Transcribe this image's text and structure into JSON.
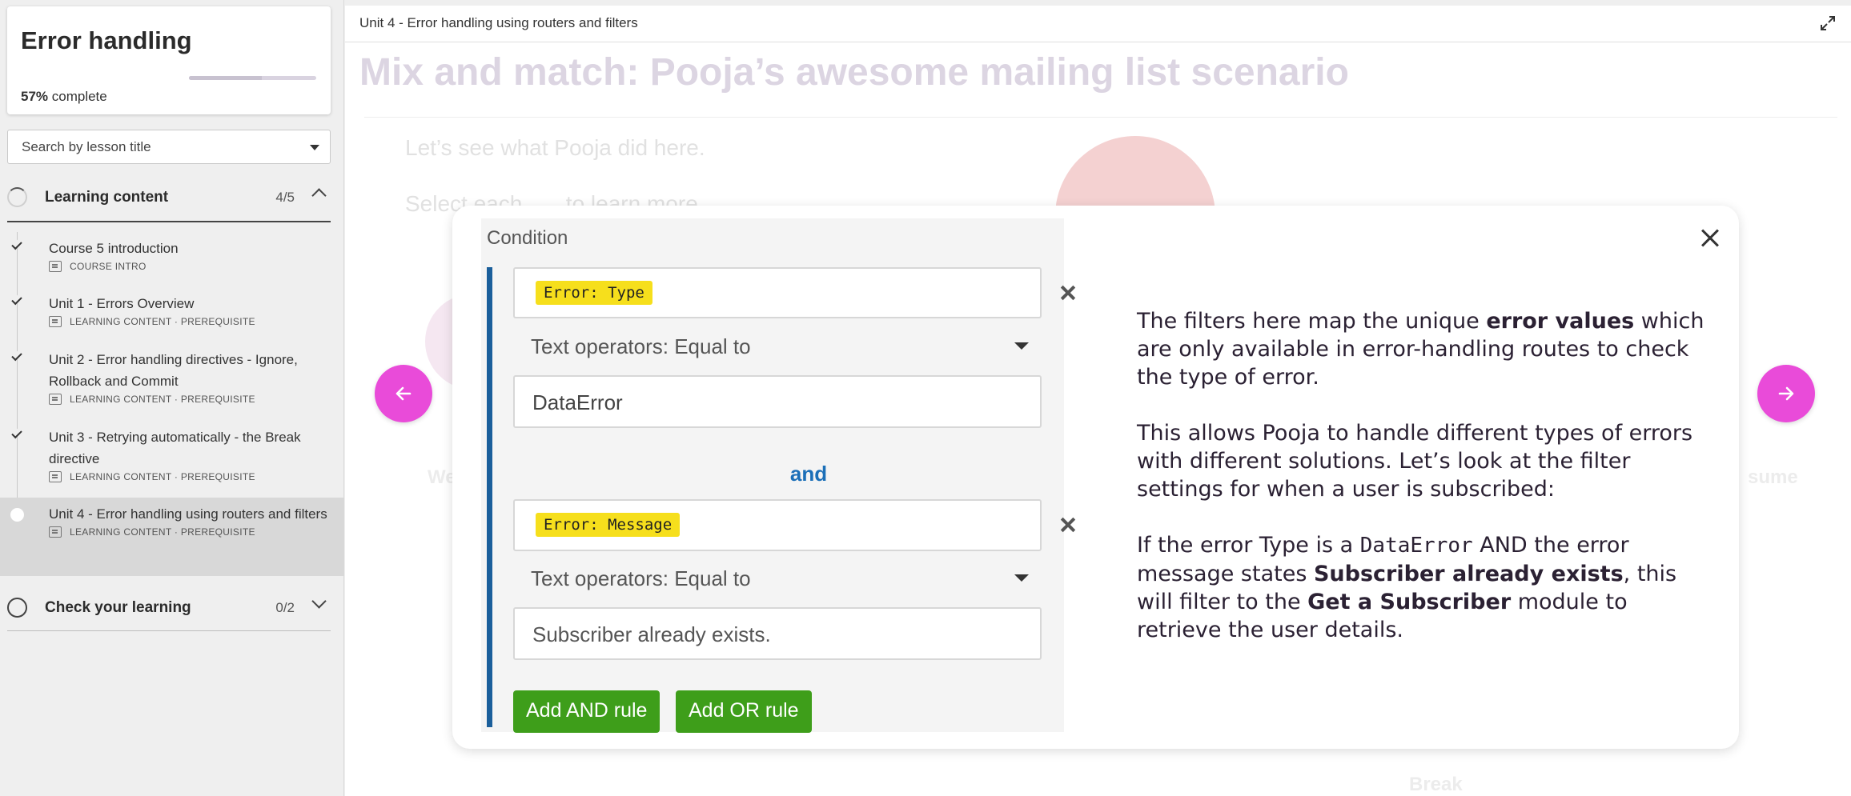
{
  "course": {
    "title": "Error handling",
    "progress_percent": "57%",
    "progress_suffix": " complete",
    "progress_fraction": 0.57
  },
  "search": {
    "placeholder": "Search by lesson title"
  },
  "sections": [
    {
      "label": "Learning content",
      "count": "4/5",
      "expanded": true
    },
    {
      "label": "Check your learning",
      "count": "0/2",
      "expanded": false
    }
  ],
  "lessons": [
    {
      "title": "Course 5 introduction",
      "meta": "COURSE INTRO",
      "completed": true
    },
    {
      "title": "Unit 1 - Errors Overview",
      "meta": "LEARNING CONTENT · PREREQUISITE",
      "completed": true
    },
    {
      "title": "Unit 2 - Error handling directives - Ignore, Rollback and Commit",
      "meta": "LEARNING CONTENT · PREREQUISITE",
      "completed": true
    },
    {
      "title": "Unit 3 - Retrying automatically - the Break directive",
      "meta": "LEARNING CONTENT · PREREQUISITE",
      "completed": true
    },
    {
      "title": "Unit 4 - Error handling using routers and filters",
      "meta": "LEARNING CONTENT · PREREQUISITE",
      "completed": false,
      "active": true
    }
  ],
  "header": {
    "breadcrumb": "Unit 4 - Error handling using routers and filters"
  },
  "background": {
    "title": "Mix and match: Pooja’s awesome mailing list scenario",
    "line1": "Let’s see what Pooja did here.",
    "line2": "Select each",
    "line2_end": "to learn more.",
    "label_left": "We",
    "label_right": "sume",
    "label_bottom": "Break"
  },
  "condition": {
    "heading": "Condition",
    "rule1": {
      "tag": "Error: Type",
      "operator": "Text operators: Equal to",
      "value": "DataError"
    },
    "joiner": "and",
    "rule2": {
      "tag": "Error: Message",
      "operator": "Text operators: Equal to",
      "value": "Subscriber already exists."
    },
    "add_and": "Add AND rule",
    "add_or": "Add OR rule"
  },
  "explanation": {
    "p1_a": "The filters here map the unique ",
    "p1_b": "error values",
    "p1_c": " which are only available in error-handling routes to check the type of error.",
    "p2": "This allows Pooja to handle different types of errors with different solutions. Let’s look at the filter settings for when a user is subscribed:",
    "p3_a": "If the error Type is a ",
    "p3_code": "DataError",
    "p3_b": " AND the error message states ",
    "p3_bold1": "Subscriber already exists",
    "p3_c": ", this will filter to the ",
    "p3_bold2": "Get a Subscriber",
    "p3_d": " module to retrieve the user details."
  },
  "colors": {
    "accent": "#e94bd9",
    "tag_yellow": "#f6df1c",
    "button_green": "#3e9e1a",
    "condition_bar": "#1b5f9b",
    "and_blue": "#1b6fb8"
  },
  "icons": {
    "expand": "expand-icon",
    "prev": "arrow-left-icon",
    "next": "arrow-right-icon",
    "close": "close-icon",
    "check": "check-icon",
    "lesson_type": "document-icon"
  }
}
